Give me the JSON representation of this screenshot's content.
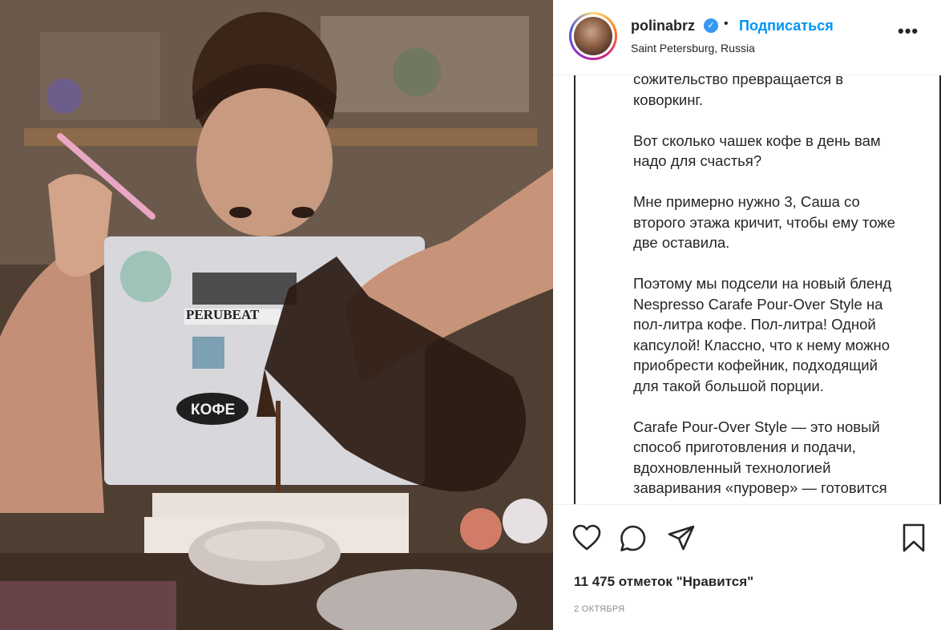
{
  "post": {
    "photo_alt_icon": "post-photo",
    "username": "polinabrz",
    "separator": "•",
    "follow_label": "Подписаться",
    "location": "Saint Petersburg, Russia",
    "more_icon": "more-options-icon",
    "more_label": "•••"
  },
  "caption": {
    "text": "сожительство превращается в\nковоркинг.\n\nВот сколько чашек кофе в день вам\nнадо для счастья?\n\nМне примерно нужно 3, Саша со\nвторого этажа кричит, чтобы ему тоже\nдве оставила.\n\nПоэтому мы подсели на новый бленд\nNespresso Carafe Pour-Over Style на\nпол-литра кофе. Пол-литра! Одной\nкапсулой! Классно, что к нему можно\nприобрести кофейник, подходящий\nдля такой большой порции.\n\nCarafe Pour-Over Style — это новый\nспособ приготовления и подачи,\nвдохновленный технологией\nзаваривания «пуровер» — готовится"
  },
  "actions": {
    "like_icon": "heart-icon",
    "comment_icon": "comment-icon",
    "share_icon": "send-icon",
    "save_icon": "bookmark-icon",
    "likes_text": "11 475 отметок \"Нравится\"",
    "date": "2 ОКТЯБРЯ"
  },
  "photo_stickers": {
    "sticker_1": "PERUBEAT",
    "sticker_2": "КОФЕ"
  },
  "colors": {
    "accent": "#0095f6",
    "verified": "#3897f0",
    "text": "#262626",
    "muted": "#8e8e8e"
  }
}
